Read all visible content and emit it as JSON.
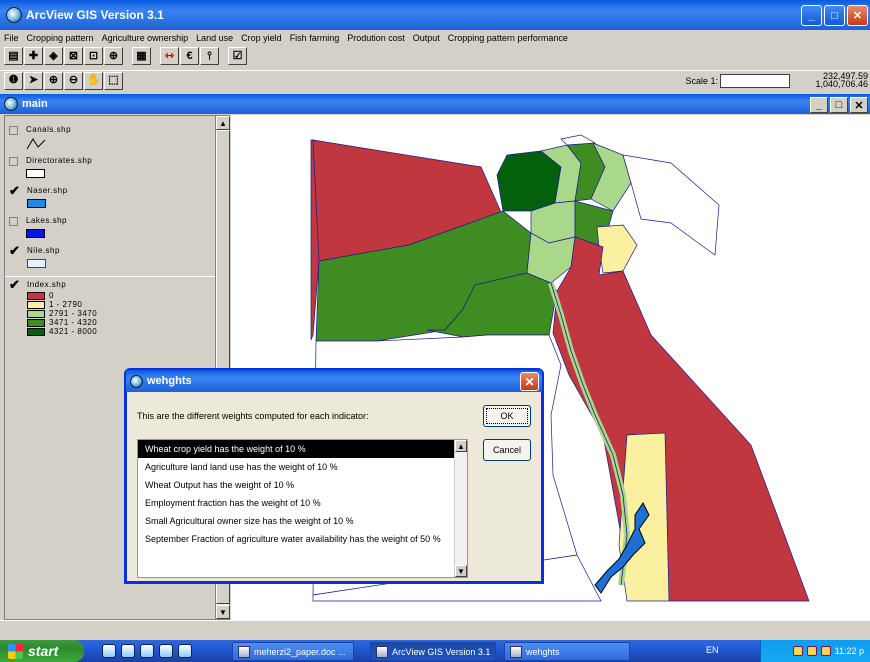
{
  "app": {
    "title": "ArcView GIS Version 3.1"
  },
  "menu": [
    "File",
    "Cropping pattern",
    "Agriculture ownership",
    "Land use",
    "Crop yield",
    "Fish farming",
    "Prodution cost",
    "Output",
    "Cropping pattern performance"
  ],
  "toolbar": {
    "scale_label": "Scale 1:",
    "scale_value": "",
    "coord_x": "232,497.59",
    "coord_y": "1,040,706.46"
  },
  "view": {
    "title": "main"
  },
  "toc": {
    "themes": [
      {
        "name": "Canals.shp",
        "checked": false
      },
      {
        "name": "Directorates.shp",
        "checked": false
      },
      {
        "name": "Naser.shp",
        "checked": true
      },
      {
        "name": "Lakes.shp",
        "checked": false
      },
      {
        "name": "Nile.shp",
        "checked": true
      },
      {
        "name": "Index.shp",
        "checked": true
      }
    ],
    "legend": [
      {
        "label": "0",
        "color": "#c0373f"
      },
      {
        "label": "1 - 2790",
        "color": "#fbf0a0"
      },
      {
        "label": "2791 - 3470",
        "color": "#a9d88b"
      },
      {
        "label": "3471 - 4320",
        "color": "#3f8d22"
      },
      {
        "label": "4321 - 8000",
        "color": "#03600d"
      }
    ]
  },
  "dialog": {
    "title": "wehghts",
    "message": "This are the different weights computed for each indicator:",
    "ok_label": "OK",
    "cancel_label": "Cancel",
    "items": [
      "Wheat crop yield has the weight of 10 %",
      "Agriculture land land use has the weight of 10 %",
      "Wheat Output has the weight of 10 %",
      "Employment fraction has the weight of 10 %",
      "Small Agricultural owner size has the weight of 10 %",
      "September Fraction of agriculture water availability has the weight of 50 %"
    ],
    "selected_index": 0
  },
  "taskbar": {
    "start_label": "start",
    "buttons": [
      "meherzi2_paper.doc ...",
      "ArcView GIS Version 3.1",
      "wehghts"
    ],
    "lang": "EN",
    "clock": "11:22 p"
  },
  "colors": {
    "selection": "#000000",
    "xp_blue": "#245edb",
    "lake_blue": "#0018e6",
    "naser_blue": "#1f6fd8"
  }
}
